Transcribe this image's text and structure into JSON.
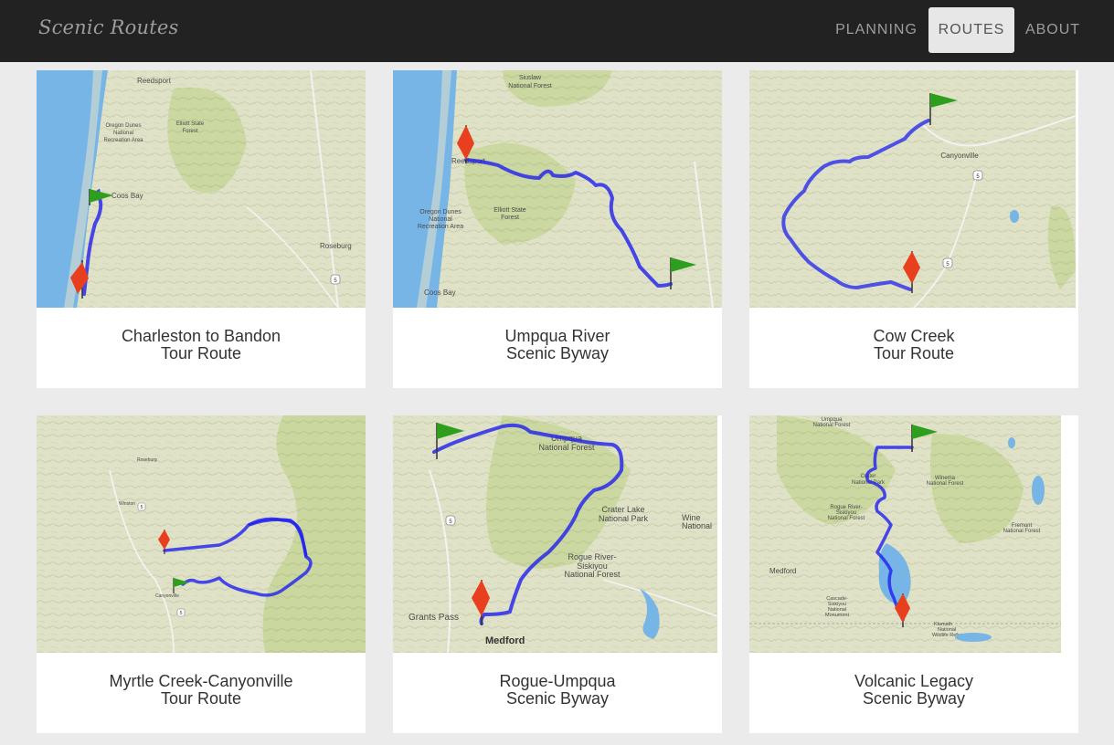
{
  "brand": "Scenic Routes",
  "nav": {
    "planning": "PLANNING",
    "routes": "ROUTES",
    "about": "ABOUT"
  },
  "colors": {
    "navbar": "#222222",
    "active_tab": "#e7e7e7",
    "route_line": "#1f1ff0",
    "start_flag": "#2e9e1e",
    "end_flag": "#e8401e",
    "water": "#77b5e6",
    "land": "#dfe3c4",
    "forest": "#c5d69a"
  },
  "routes": [
    {
      "title_line1": "Charleston to Bandon",
      "title_line2": "Tour Route",
      "map_labels": [
        "Reedsport",
        "Oregon Dunes National Recreation Area",
        "Elliott State Forest",
        "Coos Bay",
        "Roseburg",
        "5"
      ]
    },
    {
      "title_line1": "Umpqua River",
      "title_line2": "Scenic Byway",
      "map_labels": [
        "Siuslaw National Forest",
        "Reedsport",
        "Elliott State Forest",
        "Oregon Dunes National Recreation Area",
        "Coos Bay"
      ]
    },
    {
      "title_line1": "Cow Creek",
      "title_line2": "Tour Route",
      "map_labels": [
        "Canyonville",
        "5"
      ]
    },
    {
      "title_line1": "Myrtle Creek-Canyonville",
      "title_line2": "Tour Route",
      "map_labels": [
        "Roseburg",
        "Winston",
        "Canyonville",
        "5"
      ]
    },
    {
      "title_line1": "Rogue-Umpqua",
      "title_line2": "Scenic Byway",
      "map_labels": [
        "Umpqua National Forest",
        "Crater Lake National Park",
        "Rogue River-Siskiyou National Forest",
        "Wine National",
        "Grants Pass",
        "Medford",
        "5"
      ]
    },
    {
      "title_line1": "Volcanic Legacy",
      "title_line2": "Scenic Byway",
      "map_labels": [
        "Umpqua National Forest",
        "Winema National Forest",
        "Rogue River-Siskiyou National Forest",
        "Fremont National Forest",
        "Medford",
        "Cascade-Siskiyou National Monument",
        "Klamath National Wildlife Refuge"
      ]
    }
  ]
}
